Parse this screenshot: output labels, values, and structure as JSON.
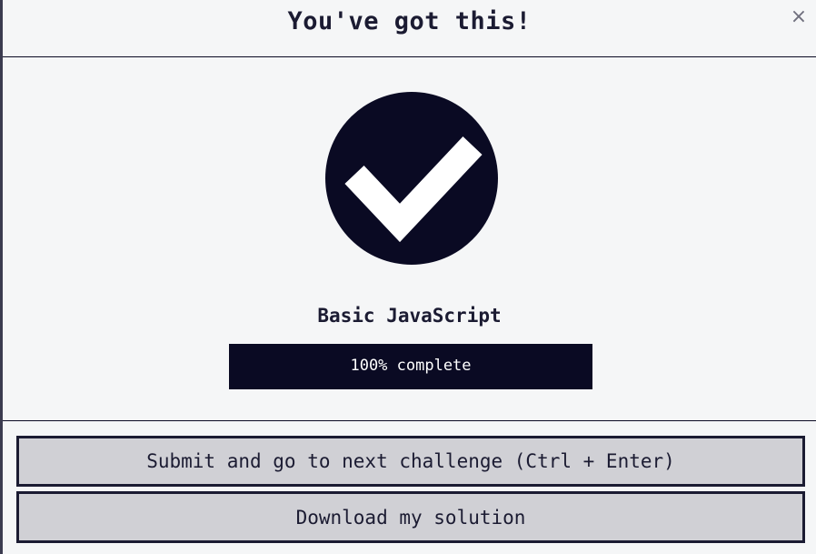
{
  "modal": {
    "title": "You've got this!",
    "close_label": "×"
  },
  "course": {
    "title": "Basic JavaScript",
    "progress_percent": 100,
    "progress_label": "100% complete"
  },
  "icons": {
    "success": "check-circle-icon"
  },
  "colors": {
    "primary": "#0a0a23",
    "background": "#f5f6f7",
    "button_bg": "#d0d0d5"
  },
  "buttons": {
    "submit_label": "Submit and go to next challenge (Ctrl + Enter)",
    "download_label": "Download my solution"
  }
}
